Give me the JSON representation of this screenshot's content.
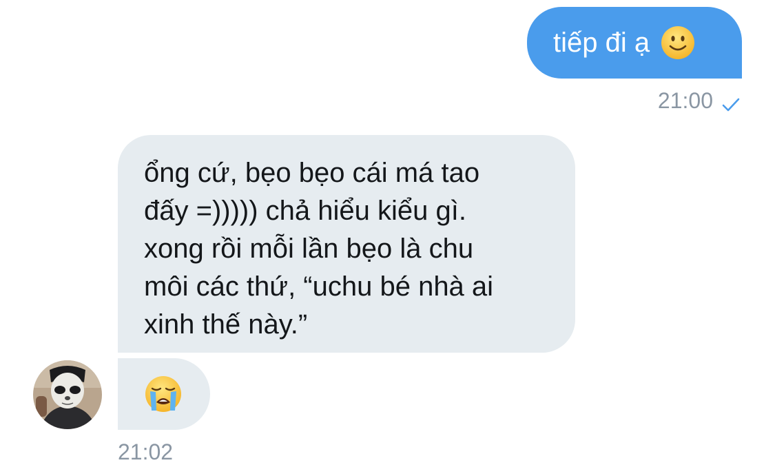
{
  "outgoing": {
    "text": "tiếp đi ạ",
    "emoji": "slightly-smiling-face",
    "time": "21:00",
    "status_icon": "check-icon",
    "bubble_color": "#4a9cec"
  },
  "incoming": {
    "lines": [
      "ổng cứ, bẹo bẹo cái má tao",
      "đấy =))))) chả hiểu kiểu gì.",
      "xong rồi mỗi lần bẹo là chu",
      "môi các thứ, “uchu bé nhà ai",
      "xinh thế này.”"
    ],
    "emoji": "loudly-crying-face",
    "time": "21:02",
    "bubble_color": "#e6ecf0"
  },
  "colors": {
    "meta_text": "#8a96a3",
    "message_text": "#14171a"
  }
}
